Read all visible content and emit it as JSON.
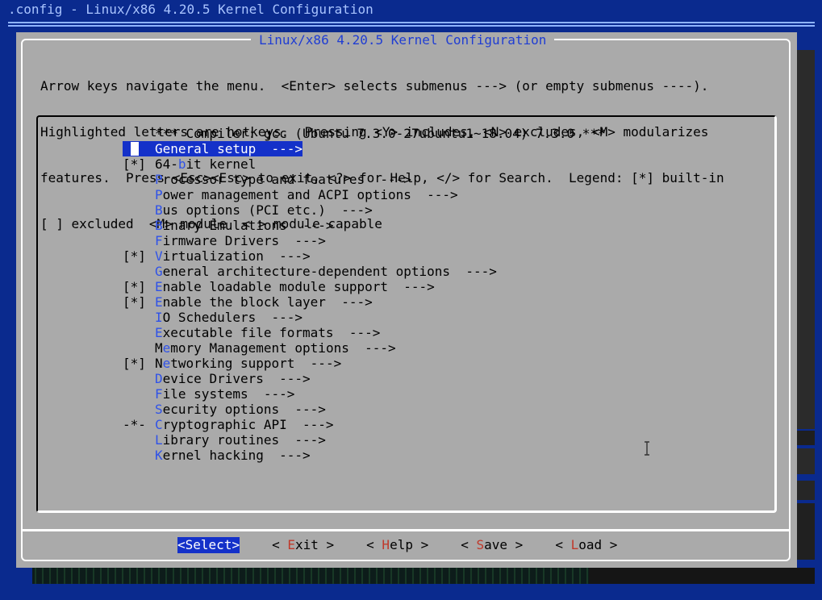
{
  "window": {
    "title": ".config - Linux/x86 4.20.5 Kernel Configuration"
  },
  "dialog": {
    "title": "Linux/x86 4.20.5 Kernel Configuration",
    "help_lines": [
      "Arrow keys navigate the menu.  <Enter> selects submenus ---> (or empty submenus ----).",
      "Highlighted letters are hotkeys.  Pressing <Y> includes, <N> excludes, <M> modularizes",
      "features.  Press <Esc><Esc> to exit, <?> for Help, </> for Search.  Legend: [*] built-in",
      "[ ] excluded  <M> module  < > module capable"
    ]
  },
  "menu": {
    "header": "*** Compiler: gcc (Ubuntu 7.3.0-27ubuntu1~18.04) 7.3.0 ***",
    "items": [
      {
        "mark": "",
        "hk": "G",
        "rest": "eneral setup  --->",
        "pre": "",
        "selected": true
      },
      {
        "mark": "[*]",
        "pre": "64-",
        "hk": "b",
        "rest": "it kernel"
      },
      {
        "mark": "",
        "pre": "",
        "hk": "P",
        "rest": "rocessor type and features  --->"
      },
      {
        "mark": "",
        "pre": "",
        "hk": "P",
        "rest": "ower management and ACPI options  --->"
      },
      {
        "mark": "",
        "pre": "",
        "hk": "B",
        "rest": "us options (PCI etc.)  --->"
      },
      {
        "mark": "",
        "pre": "",
        "hk": "B",
        "rest": "inary Emulations  --->"
      },
      {
        "mark": "",
        "pre": "",
        "hk": "F",
        "rest": "irmware Drivers  --->"
      },
      {
        "mark": "[*]",
        "pre": "",
        "hk": "V",
        "rest": "irtualization  --->"
      },
      {
        "mark": "",
        "pre": "",
        "hk": "G",
        "rest": "eneral architecture-dependent options  --->"
      },
      {
        "mark": "[*]",
        "pre": "",
        "hk": "E",
        "rest": "nable loadable module support  --->"
      },
      {
        "mark": "[*]",
        "pre": "",
        "hk": "E",
        "rest": "nable the block layer  --->"
      },
      {
        "mark": "",
        "pre": "",
        "hk": "I",
        "rest": "O Schedulers  --->"
      },
      {
        "mark": "",
        "pre": "",
        "hk": "E",
        "rest": "xecutable file formats  --->"
      },
      {
        "mark": "",
        "pre": "M",
        "hk": "e",
        "rest": "mory Management options  --->"
      },
      {
        "mark": "[*]",
        "pre": "N",
        "hk": "e",
        "rest": "tworking support  --->"
      },
      {
        "mark": "",
        "pre": "",
        "hk": "D",
        "rest": "evice Drivers  --->"
      },
      {
        "mark": "",
        "pre": "",
        "hk": "F",
        "rest": "ile systems  --->"
      },
      {
        "mark": "",
        "pre": "",
        "hk": "S",
        "rest": "ecurity options  --->"
      },
      {
        "mark": "-*-",
        "pre": "",
        "hk": "C",
        "rest": "ryptographic API  --->"
      },
      {
        "mark": "",
        "pre": "",
        "hk": "L",
        "rest": "ibrary routines  --->"
      },
      {
        "mark": "",
        "pre": "",
        "hk": "K",
        "rest": "ernel hacking  --->"
      }
    ]
  },
  "buttons": [
    {
      "name": "select",
      "pre": "<",
      "hk": "S",
      "rest": "elect>",
      "active": true
    },
    {
      "name": "exit",
      "pre": "< ",
      "hk": "E",
      "rest": "xit >"
    },
    {
      "name": "help",
      "pre": "< ",
      "hk": "H",
      "rest": "elp >"
    },
    {
      "name": "save",
      "pre": "< ",
      "hk": "S",
      "rest": "ave >"
    },
    {
      "name": "load",
      "pre": "< ",
      "hk": "L",
      "rest": "oad >"
    }
  ],
  "colors": {
    "background": "#0a2a8e",
    "dialog": "#aaaaaa",
    "selection": "#1431c9",
    "hotkey_menu": "#2f52e8",
    "hotkey_button": "#c0392b"
  },
  "icons": {
    "cursor": "text-ibeam-icon"
  }
}
